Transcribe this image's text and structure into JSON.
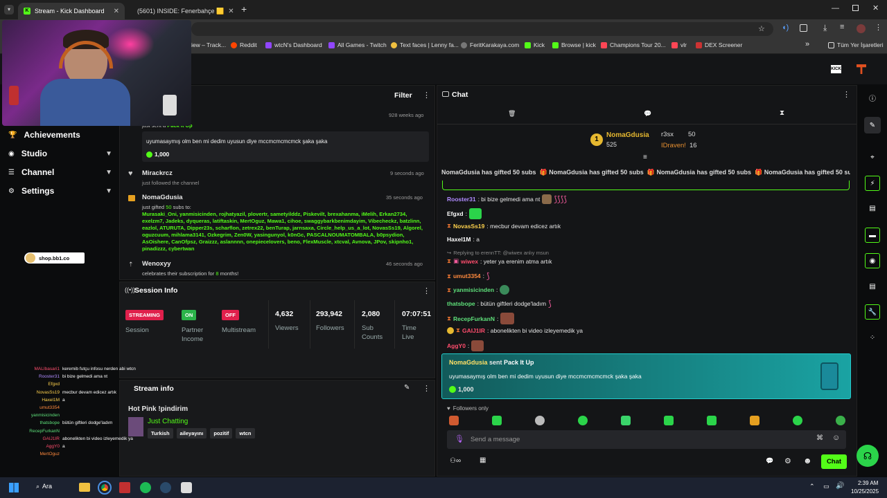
{
  "browser": {
    "tabs": [
      {
        "title": "Stream - Kick Dashboard"
      },
      {
        "title": "(5601) INSIDE: Fenerbahçe 🟨"
      }
    ],
    "new_tab": "+",
    "bookmarks": [
      "iew – Track...",
      "Reddit",
      "wtcN's Dashboard",
      "All Games - Twitch",
      "Text faces | Lenny fa...",
      "FeritKarakaya.com",
      "Kick",
      "Browse | kick",
      "Champions Tour 20...",
      "vlr",
      "DEX Screener"
    ],
    "all_bookmarks": "Tüm Yer İşaretleri",
    "more": "»"
  },
  "sidebar": {
    "items": [
      {
        "label": "Achievements"
      },
      {
        "label": "Studio"
      },
      {
        "label": "Channel"
      },
      {
        "label": "Settings"
      }
    ],
    "shop_badge": "shop.bb1.co"
  },
  "activity": {
    "filter": "Filter",
    "events": [
      {
        "time": "928 weeks ago",
        "desc": "just sent a Pack It Up",
        "quote": "uyumasaymış olm ben mi dedim uyusun diye mccmcmcmcmck şaka şaka",
        "amount": "1,000"
      },
      {
        "user": "Mirackrcz",
        "desc": "just followed the channel",
        "time": "9 seconds ago"
      },
      {
        "user": "NomaGdusia",
        "desc_prefix": "just gifted ",
        "count": "50",
        "desc_suffix": " subs to:",
        "time": "35 seconds ago",
        "recipients": "Murasaki_Oni, yanmisicinden, rojhatyazil, plovertr, sametyilddz, Piskevilt, brexahanma, iMelih, Erkan2734, exelzm7, Jadeks, dyqueras, latiftaskin, MertOguz, Mawa1, cihoe, swaggybarkbenimdayim, Vibecheckz, batzlinn, eazlol, ATURUTA, Dipper23s, scharflon, zetrex22, benTurap, jarnsaxa, Circle_help_us_a_lot, NovasSs19, Algorel, oguzcuum, mihlama3141, Ozkegrim, Zen0W, yasingunyol, k0nGc, PASCALNOUMATOMBALA, b0psydion, AsOishere, CanOfpsz, Graizzz, aslannnn, onepiecelovers, beno, FlexMuscle, xtcval, Avnova, JPov, skipnho1, pinadizzz, cybertwan"
      },
      {
        "user": "Wenoxyy",
        "desc_prefix": "celebrates their subscription for ",
        "months": "8",
        "desc_suffix": " months!",
        "time": "46 seconds ago"
      }
    ]
  },
  "session": {
    "title": "Session Info",
    "streaming": "STREAMING",
    "streaming_label": "Session",
    "partner": "ON",
    "partner_label": "Partner Income",
    "multistream": "OFF",
    "multistream_label": "Multistream",
    "viewers": "4,632",
    "viewers_label": "Viewers",
    "followers": "293,942",
    "followers_label": "Followers",
    "subs": "2,080",
    "subs_label": "Sub Counts",
    "time": "07:07:51",
    "time_label": "Time Live"
  },
  "stream_info": {
    "title_label": "Stream info",
    "stream_title": "Hot Pink !pindirim",
    "category": "Just Chatting",
    "tags": [
      "Turkish",
      "aileyayını",
      "pozitif",
      "wtcn"
    ]
  },
  "chat": {
    "title": "Chat",
    "leader1": {
      "name": "NomaGdusia",
      "value": "525",
      "rank": "1"
    },
    "leader2": {
      "name": "r3sx",
      "value": "50"
    },
    "leader3": {
      "name": "IDraven!",
      "value": "16"
    },
    "ticker": "NomaGdusia has gifted 50 subs",
    "reply_to": "Replying to erennTT: @wiwex anlıy msun",
    "messages": [
      {
        "user": "Rooster31",
        "text": ": bi bize gelmedi ama nt"
      },
      {
        "user": "Efgxd",
        "text": ":"
      },
      {
        "user": "NovasSs19",
        "text": ": mecbur devam edicez artık"
      },
      {
        "user": "Haxel1M",
        "text": ": a"
      },
      {
        "user": "wiwex",
        "text": ": yeter ya erenim atma artık"
      },
      {
        "user": "umut3354",
        "text": ":"
      },
      {
        "user": "yanmisicinden",
        "text": ":"
      },
      {
        "user": "thatsbope",
        "text": ": bütün giftleri dodge'ladım"
      },
      {
        "user": "RecepFurkanN",
        "text": ":"
      },
      {
        "user": "GAIJ1IR",
        "text": ": abonelikten bi video izleyemedik ya"
      },
      {
        "user": "AggY0",
        "text": ":"
      }
    ],
    "pack": {
      "sender": "NomaGdusia",
      "verb": " sent ",
      "item": "Pack It Up",
      "text": "uyumasaymış olm ben mi dedim uyusun diye mccmcmcmcmck şaka şaka",
      "amount": "1,000"
    },
    "followers_only": "Followers only",
    "placeholder": "Send a message",
    "send": "Chat"
  },
  "overlay_chat": [
    {
      "user": "MALIbasari1",
      "text": "keremib futçu infosu nerden abi wtcn",
      "color": "#ff4d6d"
    },
    {
      "user": "Rooster31",
      "text": "bi bize gelmedi ama nt",
      "color": "#b08bff"
    },
    {
      "user": "Efgxd",
      "text": "",
      "color": "#ffd24d"
    },
    {
      "user": "NovasSs19",
      "text": "mecbur devam edicez artık",
      "color": "#ffd24d"
    },
    {
      "user": "Haxel1M",
      "text": "a",
      "color": "#ffd24d"
    },
    {
      "user": "umut3354",
      "text": "",
      "color": "#ff8a3d"
    },
    {
      "user": "yanmisicinden",
      "text": "",
      "color": "#5ee07a"
    },
    {
      "user": "thatsbope",
      "text": "bütün giftleri dodge'ladım",
      "color": "#5ee07a"
    },
    {
      "user": "RecepFurkanN",
      "text": "",
      "color": "#5ee07a"
    },
    {
      "user": "GAIJ1IR",
      "text": "abonelikten bi video izleyemedik ya",
      "color": "#ff4d6d"
    },
    {
      "user": "AggY0",
      "text": "a",
      "color": "#ff4d6d"
    },
    {
      "user": "MertOguz",
      "text": "",
      "color": "#ff8a3d"
    }
  ],
  "taskbar": {
    "search": "Ara",
    "time": "2:39 AM",
    "date": "10/25/2025"
  },
  "colors": {
    "kick_green": "#53fc18",
    "streaming_red": "#e0204c",
    "teal": "#1aa3a3"
  }
}
